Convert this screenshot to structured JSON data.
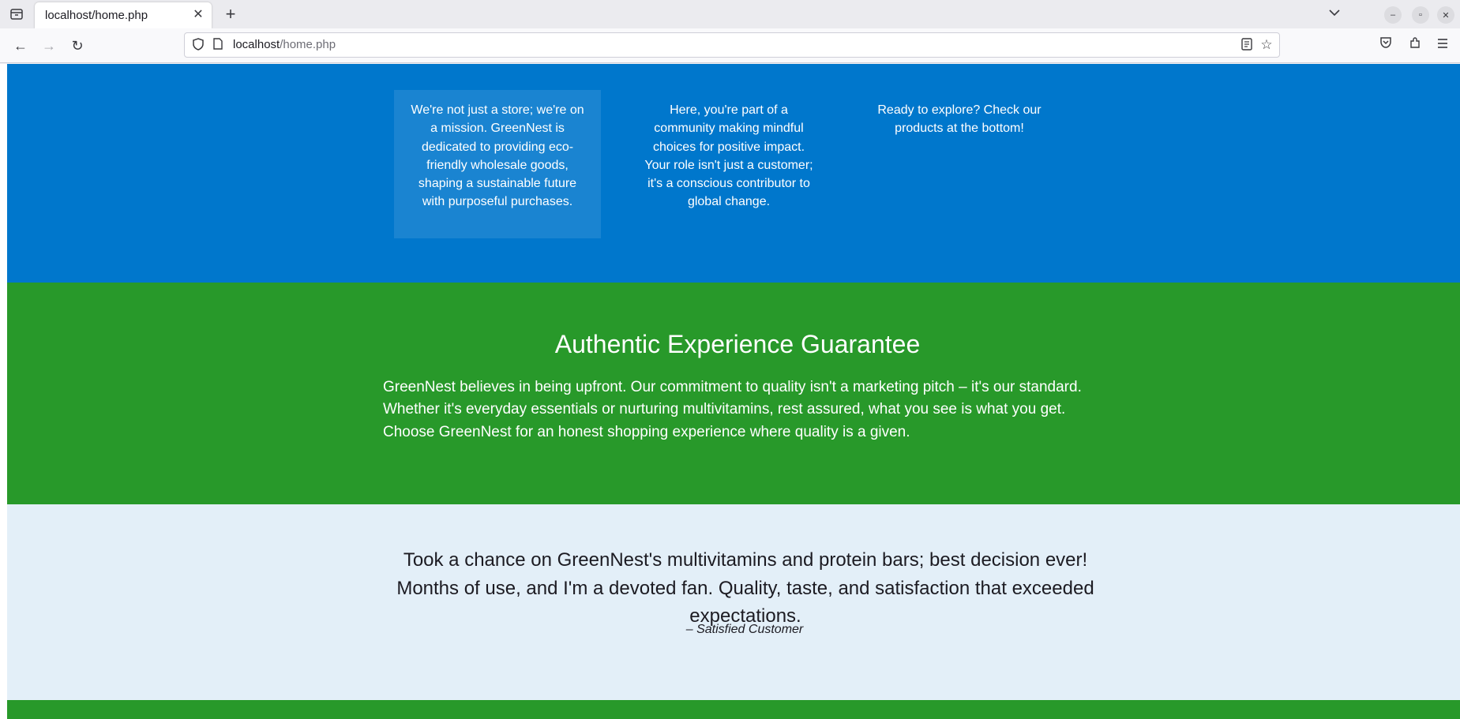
{
  "browser": {
    "tab_title": "localhost/home.php",
    "url_host": "localhost",
    "url_path": "/home.php",
    "icons": {
      "tab_list": "tab-list-icon",
      "tab_close": "close-icon",
      "new_tab": "plus-icon",
      "overflow": "chevron-down-icon",
      "back": "back-arrow-icon",
      "forward": "forward-arrow-icon",
      "reload": "reload-icon",
      "shield": "shield-icon",
      "page": "page-icon",
      "reader": "reader-view-icon",
      "bookmark": "star-icon",
      "pocket": "pocket-icon",
      "extensions": "extensions-icon",
      "menu": "hamburger-menu-icon"
    }
  },
  "mission": {
    "cards": [
      {
        "text": "We're not just a store; we're on a mission. GreenNest is dedicated to providing eco-friendly wholesale goods, shaping a sustainable future with purposeful purchases."
      },
      {
        "text": "Here, you're part of a community making mindful choices for positive impact. Your role isn't just a customer; it's a conscious contributor to global change."
      },
      {
        "text": "Ready to explore? Check our products at the bottom!"
      }
    ]
  },
  "guarantee": {
    "title": "Authentic Experience Guarantee",
    "text": "GreenNest believes in being upfront. Our commitment to quality isn't a marketing pitch – it's our standard. Whether it's everyday essentials or nurturing multivitamins, rest assured, what you see is what you get. Choose GreenNest for an honest shopping experience where quality is a given."
  },
  "testimonial": {
    "quote": "Took a chance on GreenNest's multivitamins and protein bars; best decision ever! Months of use, and I'm a devoted fan. Quality, taste, and satisfaction that exceeded expectations.",
    "author": "– Satisfied Customer"
  },
  "colors": {
    "mission_bg": "#0077cc",
    "guarantee_bg": "#28992a",
    "testimonial_bg": "#e3eff8"
  }
}
